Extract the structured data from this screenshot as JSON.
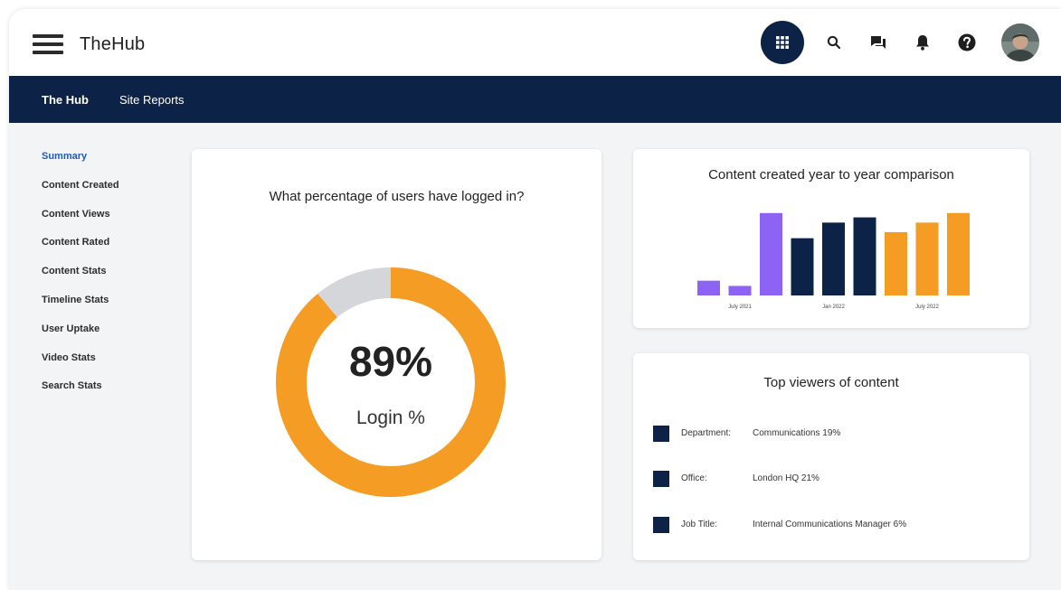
{
  "header": {
    "app_title": "TheHub",
    "apps_icon": "apps-grid-icon",
    "search_icon": "search-icon",
    "chat_icon": "chat-icon",
    "bell_icon": "bell-icon",
    "help_icon": "help-icon"
  },
  "nav": {
    "items": [
      {
        "label": "The Hub",
        "active": true
      },
      {
        "label": "Site Reports",
        "active": false
      }
    ]
  },
  "sidebar": {
    "items": [
      {
        "label": "Summary",
        "active": true
      },
      {
        "label": "Content Created"
      },
      {
        "label": "Content Views"
      },
      {
        "label": "Content Rated"
      },
      {
        "label": "Content Stats"
      },
      {
        "label": "Timeline Stats"
      },
      {
        "label": "User Uptake"
      },
      {
        "label": "Video Stats"
      },
      {
        "label": "Search Stats"
      }
    ]
  },
  "login_card": {
    "title": "What percentage of users have logged in?",
    "value_text": "89%",
    "label": "Login %",
    "percent": 89
  },
  "content_card": {
    "title": "Content created year to year comparison"
  },
  "viewers_card": {
    "title": "Top viewers of content",
    "rows": [
      {
        "key": "Department:",
        "value": "Communications  19%"
      },
      {
        "key": "Office:",
        "value": "London HQ  21%"
      },
      {
        "key": "Job Title:",
        "value": "Internal Communications Manager  6%"
      }
    ]
  },
  "colors": {
    "navy": "#0c2347",
    "orange": "#f59c24",
    "purple": "#8c63f5",
    "gray": "#d4d6d9",
    "link_blue": "#1f5bc4"
  },
  "chart_data": [
    {
      "type": "pie",
      "title": "What percentage of users have logged in?",
      "values": [
        89,
        11
      ]
    },
    {
      "type": "bar",
      "title": "Content created year to year comparison",
      "categories": [
        "",
        "July 2021",
        "",
        "",
        "Jan 2022",
        "",
        "",
        "July 2022",
        ""
      ],
      "values": [
        17,
        11,
        95,
        66,
        84,
        90,
        73,
        84,
        95
      ],
      "ylim": [
        0,
        100
      ],
      "bar_colors": [
        "#8c63f5",
        "#8c63f5",
        "#8c63f5",
        "#0c2347",
        "#0c2347",
        "#0c2347",
        "#f59c24",
        "#f59c24",
        "#f59c24"
      ],
      "grid": false
    }
  ]
}
